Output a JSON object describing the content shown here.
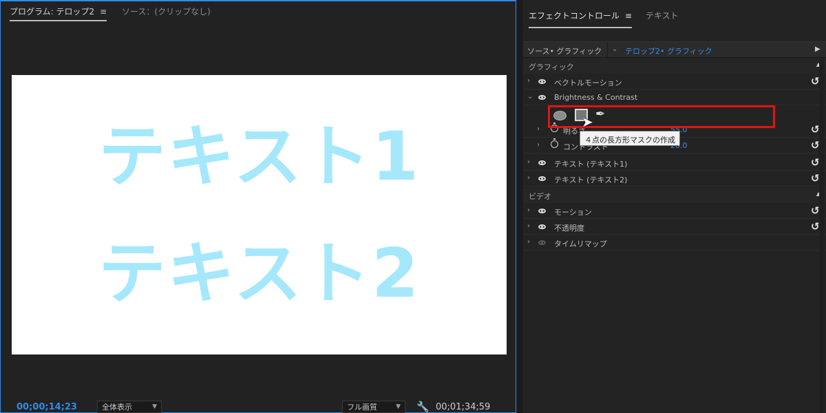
{
  "program_monitor": {
    "tab_program": "プログラム: テロップ2",
    "tab_menu_glyph": "≡",
    "tab_source": "ソース：(クリップなし)",
    "captions": [
      "テキスト1",
      "テキスト2"
    ],
    "timecode_current": "00;00;14;23",
    "zoom_select": "全体表示",
    "quality_select": "フル画質",
    "timecode_duration": "00;01;34;59"
  },
  "effect_controls": {
    "tab_effect_controls": "エフェクトコントロール",
    "tab_menu_glyph": "≡",
    "tab_text": "テキスト",
    "source_label": "ソース• グラフィック",
    "clip_label": "テロップ2• グラフィック",
    "section_graphic": "グラフィック",
    "section_video": "ビデオ",
    "rows_graphic": [
      {
        "label": "ベクトルモーション"
      },
      {
        "label": "Brightness & Contrast"
      },
      {
        "label": "テキスト (テキスト1)"
      },
      {
        "label": "テキスト (テキスト2)"
      }
    ],
    "params": [
      {
        "label": "明るさ",
        "value": "55.0"
      },
      {
        "label": "コントラスト",
        "value": "20.0"
      }
    ],
    "rows_video": [
      {
        "label": "モーション"
      },
      {
        "label": "不透明度"
      },
      {
        "label": "タイムリマップ"
      }
    ],
    "tooltip": "４点の長方形マスクの作成"
  },
  "icons": {
    "menu": "hamburger-icon",
    "twirl": "chevron-right-icon",
    "eye": "eye-icon",
    "reset": "reset-icon",
    "stopwatch": "stopwatch-icon",
    "mask_ellipse": "ellipse-mask-icon",
    "mask_rect": "rectangle-mask-icon",
    "mask_pen": "pen-mask-icon",
    "wrench": "wrench-icon"
  },
  "colors": {
    "accent_blue": "#2e8bea",
    "caption_cyan": "#a6e8fb",
    "highlight_red": "#e01414"
  }
}
